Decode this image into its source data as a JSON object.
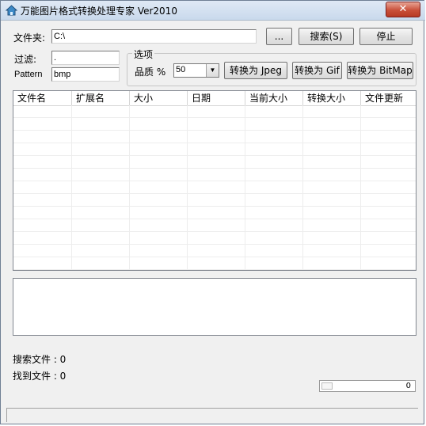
{
  "window": {
    "title": "万能图片格式转换处理专家 Ver2010",
    "close_label": "✕"
  },
  "folder": {
    "label": "文件夹:",
    "value": "C:\\",
    "browse_label": "...",
    "search_label": "搜索(S)",
    "stop_label": "停止"
  },
  "filter": {
    "label": "过滤:",
    "value": ".",
    "pattern_label": "Pattern",
    "pattern_value": "bmp"
  },
  "options": {
    "title": "选项",
    "quality_label": "品质 %",
    "quality_value": "50",
    "to_jpeg_label": "转换为 Jpeg",
    "to_gif_label": "转换为 Gif",
    "to_bitmap_label": "转换为 BitMap"
  },
  "table": {
    "columns": [
      "文件名",
      "扩展名",
      "大小",
      "日期",
      "当前大小",
      "转换大小",
      "文件更新"
    ]
  },
  "status": {
    "search_files": "搜索文件 : 0",
    "found_files": "找到文件 : 0",
    "progress_value": "0",
    "progress_fraction": 0
  }
}
